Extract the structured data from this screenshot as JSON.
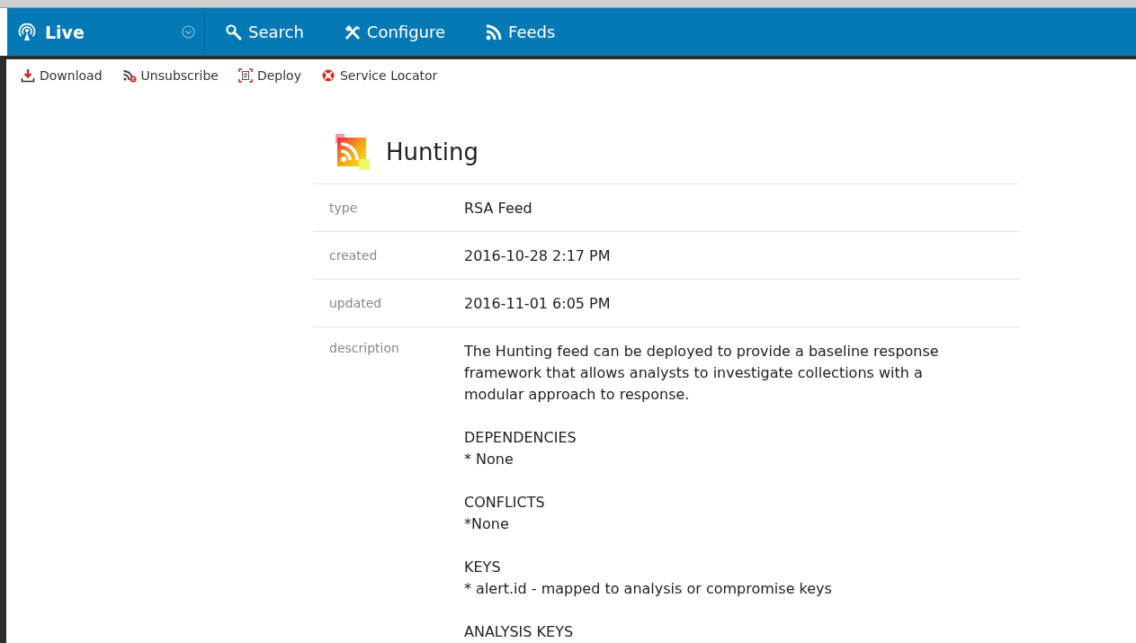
{
  "nav": {
    "module": {
      "label": "Live"
    },
    "items": [
      {
        "label": "Search",
        "kind": "search"
      },
      {
        "label": "Configure",
        "kind": "tools"
      },
      {
        "label": "Feeds",
        "kind": "rss"
      }
    ]
  },
  "toolbar": [
    {
      "label": "Download",
      "kind": "download"
    },
    {
      "label": "Unsubscribe",
      "kind": "unsubscribe"
    },
    {
      "label": "Deploy",
      "kind": "deploy"
    },
    {
      "label": "Service Locator",
      "kind": "locator"
    }
  ],
  "feed": {
    "title": "Hunting",
    "fields": [
      {
        "label": "type",
        "value": "RSA Feed"
      },
      {
        "label": "created",
        "value": "2016-10-28 2:17 PM"
      },
      {
        "label": "updated",
        "value": "2016-11-01 6:05 PM"
      }
    ],
    "description": {
      "label": "description",
      "paragraphs": [
        [
          "The Hunting feed can be deployed to provide a baseline response",
          "framework that allows analysts to investigate collections with a",
          "modular approach to response."
        ],
        [
          "DEPENDENCIES",
          "* None"
        ],
        [
          "CONFLICTS",
          "*None"
        ],
        [
          "KEYS",
          "* alert.id - mapped to analysis or compromise keys"
        ],
        [
          "ANALYSIS KEYS"
        ]
      ]
    }
  }
}
